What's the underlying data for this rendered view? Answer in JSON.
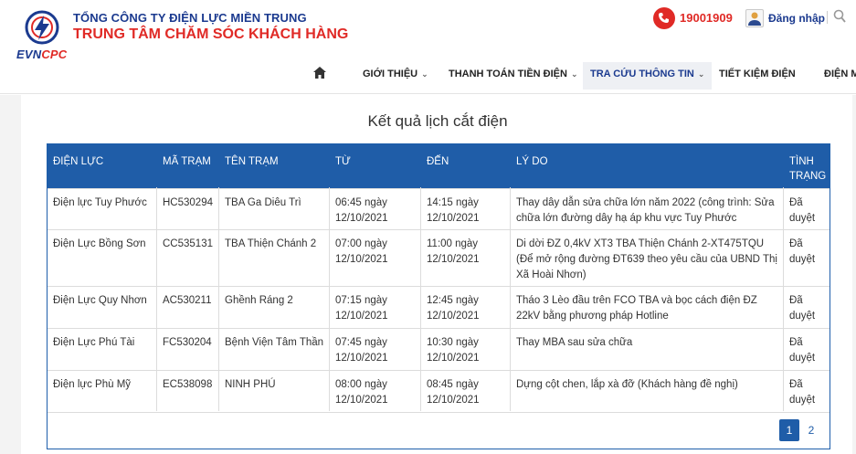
{
  "header": {
    "brand_line1": "TỔNG CÔNG TY ĐIỆN LỰC MIỀN TRUNG",
    "brand_line2": "TRUNG TÂM CHĂM SÓC KHÁCH HÀNG",
    "evn_prefix": "EVN",
    "evn_suffix": "CPC",
    "hotline": "19001909",
    "login_label": "Đăng nhập"
  },
  "nav": {
    "items": [
      {
        "label": "GIỚI THIỆU",
        "dropdown": true
      },
      {
        "label": "THANH TOÁN TIỀN ĐIỆN",
        "dropdown": true
      },
      {
        "label": "TRA CỨU THÔNG TIN",
        "dropdown": true,
        "active": true
      },
      {
        "label": "TIẾT KIỆM ĐIỆN",
        "dropdown": false
      },
      {
        "label": "ĐIỆN M",
        "dropdown": false
      }
    ]
  },
  "page": {
    "title": "Kết quả lịch cắt điện"
  },
  "table": {
    "columns": [
      "ĐIỆN LỰC",
      "MÃ TRẠM",
      "TÊN TRẠM",
      "TỪ",
      "ĐẾN",
      "LÝ DO",
      "TÌNH TRẠNG"
    ],
    "rows": [
      {
        "dien_luc": "Điện lực Tuy Phước",
        "ma_tram": "HC530294",
        "ten_tram": "TBA Ga Diêu Trì",
        "tu": "06:45 ngày 12/10/2021",
        "den": "14:15 ngày 12/10/2021",
        "ly_do": "Thay dây dẫn sửa chữa lớn năm 2022 (công trình: Sửa chữa lớn đường dây hạ áp khu vực Tuy Phước",
        "tinh_trang": "Đã duyệt"
      },
      {
        "dien_luc": "Điện Lực Bồng Sơn",
        "ma_tram": "CC535131",
        "ten_tram": "TBA Thiện Chánh 2",
        "tu": "07:00 ngày 12/10/2021",
        "den": "11:00 ngày 12/10/2021",
        "ly_do": "Di dời ĐZ 0,4kV XT3 TBA Thiện Chánh 2-XT475TQU (Để mở rộng đường ĐT639 theo yêu cầu của UBND Thị Xã Hoài Nhơn)",
        "tinh_trang": "Đã duyệt"
      },
      {
        "dien_luc": "Điện Lực Quy Nhơn",
        "ma_tram": "AC530211",
        "ten_tram": "Ghềnh Ráng 2",
        "tu": "07:15 ngày 12/10/2021",
        "den": "12:45 ngày 12/10/2021",
        "ly_do": "Tháo 3 Lèo đầu trên FCO TBA và bọc cách điện ĐZ 22kV bằng phương pháp Hotline",
        "tinh_trang": "Đã duyệt"
      },
      {
        "dien_luc": "Điện Lực Phú Tài",
        "ma_tram": "FC530204",
        "ten_tram": "Bệnh Viện Tâm Thần",
        "tu": "07:45 ngày 12/10/2021",
        "den": "10:30 ngày 12/10/2021",
        "ly_do": "Thay MBA sau sửa chữa",
        "tinh_trang": "Đã duyệt"
      },
      {
        "dien_luc": "Điện lực Phù Mỹ",
        "ma_tram": "EC538098",
        "ten_tram": "NINH PHÚ",
        "tu": "08:00 ngày 12/10/2021",
        "den": "08:45 ngày 12/10/2021",
        "ly_do": "Dựng cột chen, lắp xà đỡ (Khách hàng đề nghị)",
        "tinh_trang": "Đã duyệt"
      }
    ]
  },
  "pagination": {
    "current": "1",
    "next": "2"
  },
  "colors": {
    "brand_blue": "#1b3a8f",
    "brand_red": "#e02a26",
    "table_header": "#1f5da8"
  }
}
